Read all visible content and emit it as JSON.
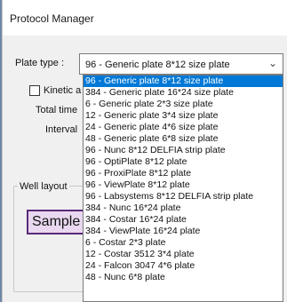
{
  "window": {
    "title": "Protocol Manager"
  },
  "plate_type": {
    "label": "Plate type :",
    "selected_value": "96 - Generic plate 8*12  size plate",
    "chevron_icon": "chevron-down-icon",
    "options": [
      "96 - Generic plate 8*12  size plate",
      "384 - Generic plate 16*24  size plate",
      "6 - Generic plate 2*3  size plate",
      "12 - Generic plate 3*4  size plate",
      "24 - Generic plate 4*6  size plate",
      "48 - Generic plate 6*8  size plate",
      "96 - Nunc 8*12 DELFIA strip plate",
      "96 - OptiPlate 8*12 plate",
      "96 - ProxiPlate 8*12 plate",
      "96 - ViewPlate 8*12 plate",
      "96 - Labsystems 8*12 DELFIA strip plate",
      "384 - Nunc  16*24 plate",
      "384 - Costar 16*24 plate",
      "384 - ViewPlate 16*24 plate",
      "6 - Costar 2*3 plate",
      "12 - Costar 3512 3*4 plate",
      "24 - Falcon 3047 4*6 plate",
      "48 - Nunc 6*8 plate"
    ],
    "selected_index": 0
  },
  "kinetic": {
    "label": "Kinetic a",
    "checked": false
  },
  "total_time": {
    "label": "Total time"
  },
  "interval": {
    "label": "Interval"
  },
  "well_layout": {
    "legend": "Well layout"
  },
  "sample_button": {
    "label": "Sample"
  },
  "colors": {
    "selection": "#0078d7",
    "sample_button_bg": "#e9d8f0",
    "sample_button_border": "#5a2a7a"
  }
}
